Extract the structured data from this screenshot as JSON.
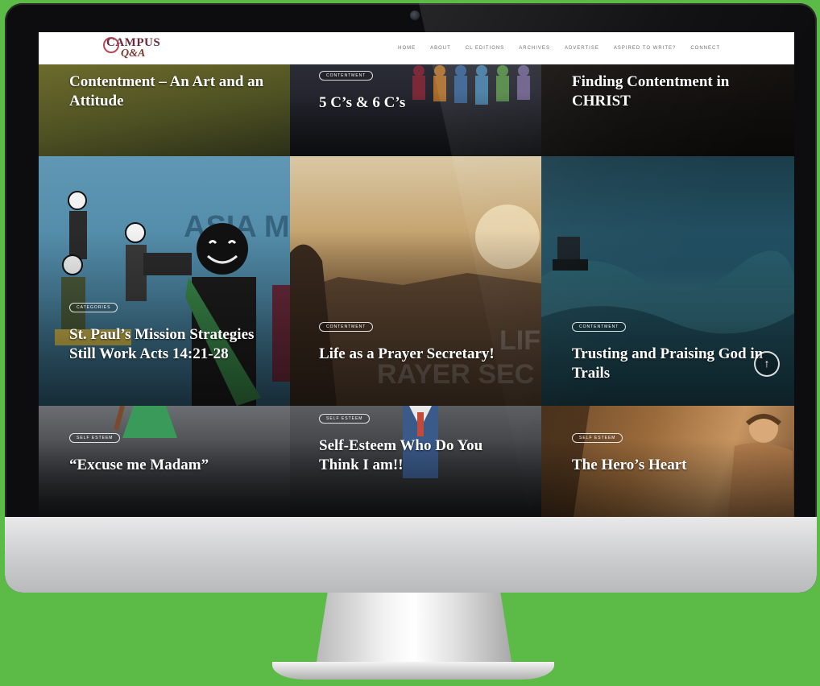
{
  "site": {
    "logo_top": "CAMPUS",
    "logo_bottom": "Q&A"
  },
  "nav": {
    "items": [
      {
        "label": "HOME"
      },
      {
        "label": "ABOUT"
      },
      {
        "label": "CL EDITIONS"
      },
      {
        "label": "ARCHIVES"
      },
      {
        "label": "ADVERTISE"
      },
      {
        "label": "ASPIRED TO WRITE?"
      },
      {
        "label": "CONNECT"
      }
    ]
  },
  "posts": [
    {
      "title": "Contentment – An Art and an Attitude",
      "tag": ""
    },
    {
      "title": "5 C’s & 6 C’s",
      "tag": "CONTENTMENT"
    },
    {
      "title": "Finding Contentment in CHRIST",
      "tag": ""
    },
    {
      "title": "St. Paul’s Mission Strategies Still Work Acts 14:21-28",
      "tag": "CATEGORIES"
    },
    {
      "title": "Life as a Prayer Secretary!",
      "tag": "CONTENTMENT"
    },
    {
      "title": "Trusting and Praising God in Trails",
      "tag": "CONTENTMENT"
    },
    {
      "title": "“Excuse me Madam”",
      "tag": "SELF ESTEEM"
    },
    {
      "title": "Self-Esteem Who Do You Think I am!!",
      "tag": "SELF ESTEEM"
    },
    {
      "title": "The Hero’s Heart",
      "tag": "SELF ESTEEM"
    }
  ],
  "scroll_top_icon": "↑"
}
